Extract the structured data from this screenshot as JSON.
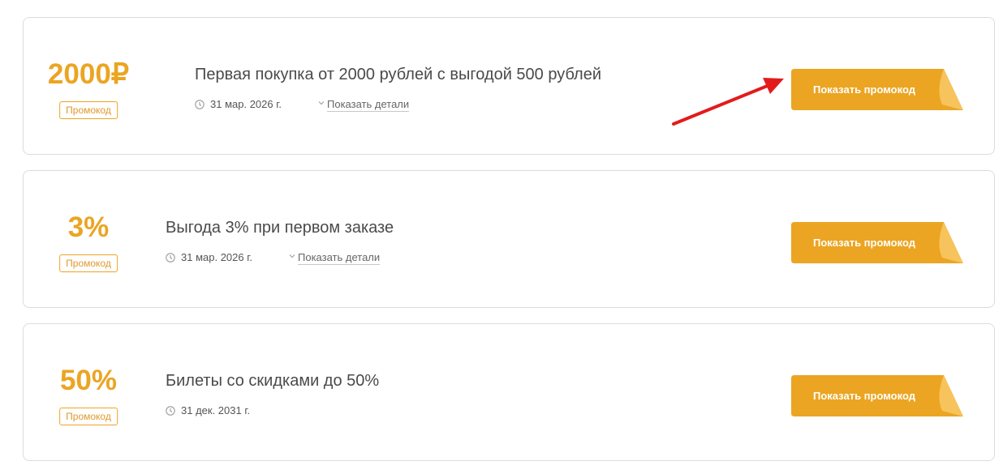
{
  "offers": [
    {
      "value": "2000₽",
      "badge": "Промокод",
      "title": "Первая покупка от 2000 рублей с выгодой 500 рублей",
      "date": "31 мар. 2026 г.",
      "details_label": "Показать детали",
      "button_label": "Показать промокод"
    },
    {
      "value": "3%",
      "badge": "Промокод",
      "title": "Выгода 3% при первом заказе",
      "date": "31 мар. 2026 г.",
      "details_label": "Показать детали",
      "button_label": "Показать промокод"
    },
    {
      "value": "50%",
      "badge": "Промокод",
      "title": "Билеты со скидками до 50%",
      "date": "31 дек. 2031 г.",
      "button_label": "Показать промокод"
    }
  ],
  "colors": {
    "accent": "#eba523",
    "button": "#eba523",
    "button_fold": "#f7c35c",
    "annotation_arrow": "#e31b1b"
  },
  "icons": [
    "clock-icon",
    "chevron-down-icon",
    "annotation-arrow-icon"
  ]
}
